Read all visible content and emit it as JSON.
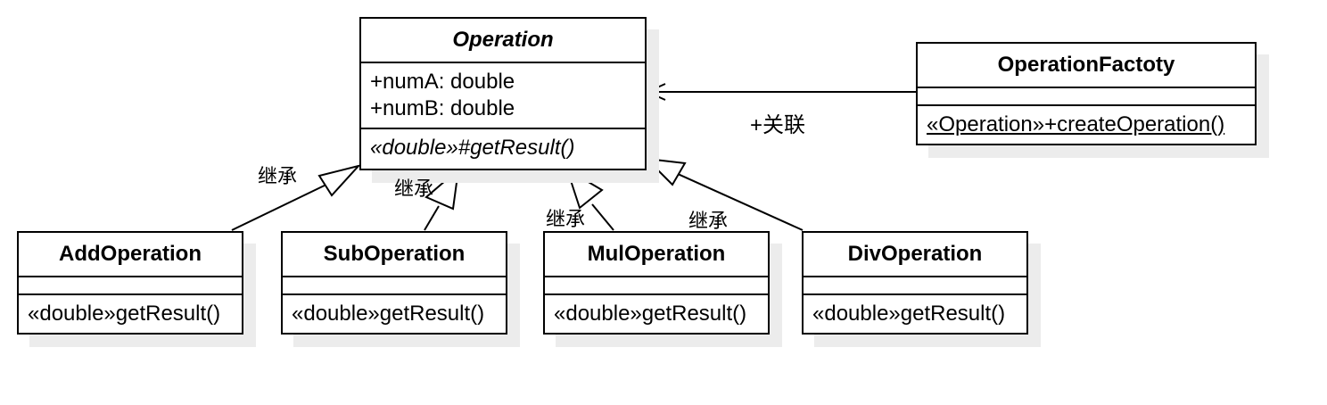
{
  "classes": {
    "operation": {
      "name": "Operation",
      "attributes": [
        "+numA: double",
        "+numB: double"
      ],
      "operations": [
        "«double»#getResult()"
      ]
    },
    "factory": {
      "name": "OperationFactoty",
      "operations": [
        "«Operation»+createOperation()"
      ]
    },
    "add": {
      "name": "AddOperation",
      "operations": [
        "«double»getResult()"
      ]
    },
    "sub": {
      "name": "SubOperation",
      "operations": [
        "«double»getResult()"
      ]
    },
    "mul": {
      "name": "MulOperation",
      "operations": [
        "«double»getResult()"
      ]
    },
    "div": {
      "name": "DivOperation",
      "operations": [
        "«double»getResult()"
      ]
    }
  },
  "relations": {
    "association_label": "+关联",
    "inheritance_labels": [
      "继承",
      "继承",
      "继承",
      "继承"
    ]
  }
}
